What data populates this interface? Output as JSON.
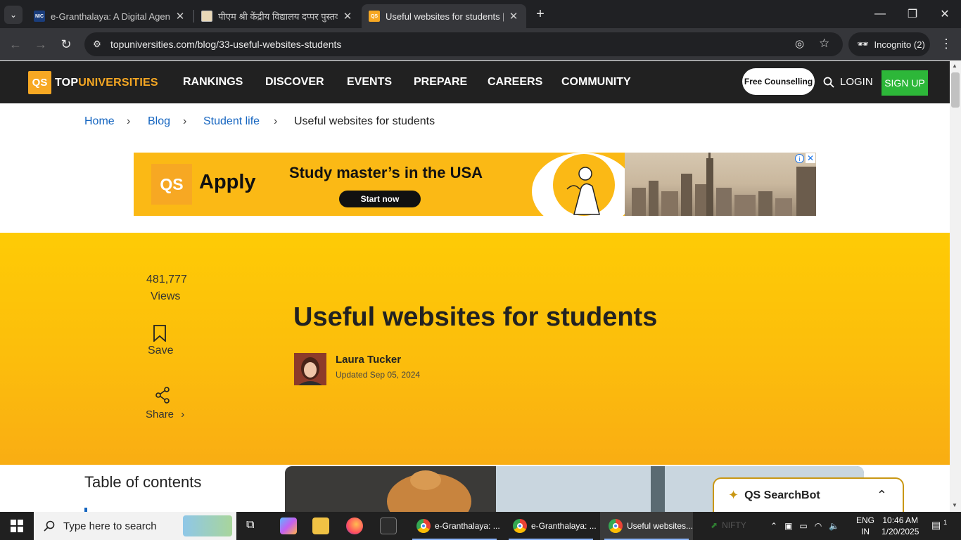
{
  "browser": {
    "tabs": [
      {
        "title": "e-Granthalaya: A Digital Agenda",
        "favicon": "NIC",
        "active": false
      },
      {
        "title": "पीएम श्री केंद्रीय विद्यालय दप्पर पुस्तकालय",
        "favicon": "",
        "active": false
      },
      {
        "title": "Useful websites for students | TopUniversities",
        "favicon": "QS",
        "active": true
      }
    ],
    "url": "topuniversities.com/blog/33-useful-websites-students",
    "profile": "Incognito (2)"
  },
  "site": {
    "logo_qs": "QS",
    "logo_top": "TOP",
    "logo_universities": "UNIVERSITIES",
    "nav": [
      "RANKINGS",
      "DISCOVER",
      "EVENTS",
      "PREPARE",
      "CAREERS",
      "COMMUNITY"
    ],
    "counselling": "Free Counselling",
    "login": "LOGIN",
    "signup": "SIGN UP"
  },
  "breadcrumb": [
    "Home",
    "Blog",
    "Student life",
    "Useful websites for students"
  ],
  "ad": {
    "logo": "QS",
    "apply": "Apply",
    "headline": "Study master’s in the USA",
    "cta": "Start now"
  },
  "article": {
    "views_count": "481,777",
    "views_label": "Views",
    "save_label": "Save",
    "share_label": "Share",
    "title": "Useful websites for students",
    "author": "Laura Tucker",
    "updated": "Updated Sep 05, 2024"
  },
  "toc_title": "Table of contents",
  "searchbot": "QS SearchBot",
  "taskbar": {
    "search_placeholder": "Type here to search",
    "apps": [
      {
        "label": "e-Granthalaya: ...",
        "active": false
      },
      {
        "label": "e-Granthalaya: ...",
        "active": false
      },
      {
        "label": "Useful websites...",
        "active": true
      }
    ],
    "tray_market": "NIFTY",
    "lang1": "ENG",
    "lang2": "IN",
    "time": "10:46 AM",
    "date": "1/20/2025",
    "notif_count": "1"
  },
  "colors": {
    "brand_yellow": "#fecb05",
    "qs_orange": "#f7a823",
    "signup_green": "#2db739",
    "link_blue": "#1565c0"
  }
}
